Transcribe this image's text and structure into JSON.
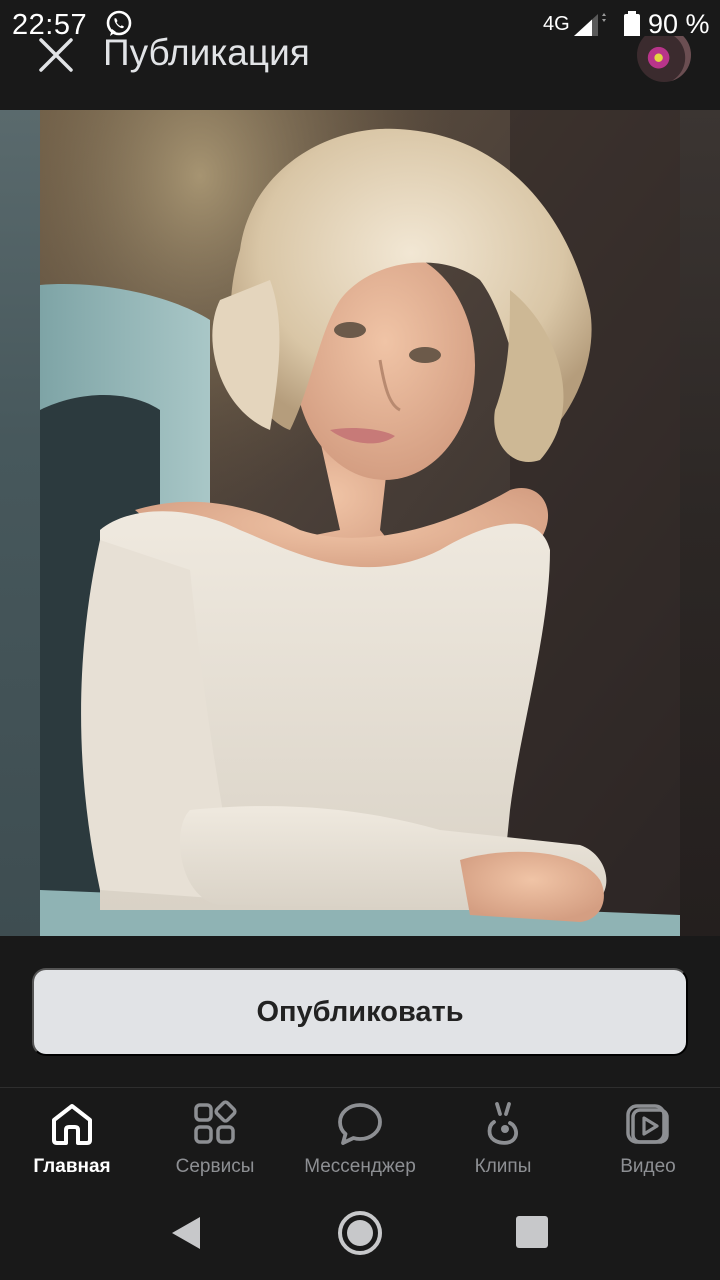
{
  "status_bar": {
    "time": "22:57",
    "network": "4G",
    "battery": "90 %",
    "icons": [
      "whatsapp-icon",
      "signal-icon",
      "battery-icon"
    ]
  },
  "header": {
    "title": "Публикация",
    "close_icon": "close-icon",
    "avatar_icon": "avatar"
  },
  "publish": {
    "label": "Опубликовать"
  },
  "nav": {
    "items": [
      {
        "label": "Главная",
        "icon": "home-icon",
        "active": true
      },
      {
        "label": "Сервисы",
        "icon": "services-icon",
        "active": false
      },
      {
        "label": "Мессенджер",
        "icon": "messenger-icon",
        "active": false
      },
      {
        "label": "Клипы",
        "icon": "clips-icon",
        "active": false
      },
      {
        "label": "Видео",
        "icon": "video-icon",
        "active": false
      }
    ]
  },
  "system_nav": {
    "icons": [
      "back-icon",
      "home-circle-icon",
      "recents-icon"
    ]
  },
  "colors": {
    "background": "#191919",
    "button_bg": "#e1e3e6",
    "nav_active": "#ffffff",
    "nav_inactive": "#8d8f93"
  }
}
